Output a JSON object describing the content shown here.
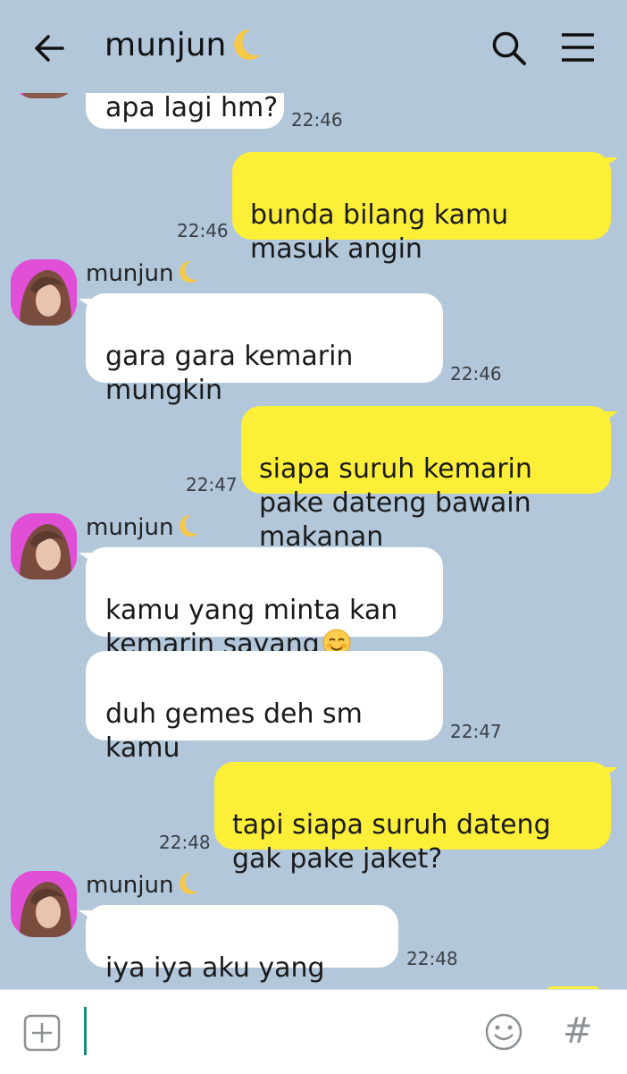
{
  "header": {
    "title": "munjun"
  },
  "messages": [
    {
      "text": "apa lagi hm?",
      "time": "22:46"
    },
    {
      "text": "bunda bilang kamu masuk angin",
      "time": "22:46"
    },
    {
      "sender": "munjun",
      "text": "gara gara kemarin mungkin",
      "time": "22:46"
    },
    {
      "text": "siapa suruh kemarin pake dateng bawain makanan",
      "time": "22:47"
    },
    {
      "sender": "munjun",
      "text": "kamu yang minta kan kemarin sayang"
    },
    {
      "text": "duh gemes deh sm kamu",
      "time": "22:47"
    },
    {
      "text": "tapi siapa suruh dateng gak pake jaket?",
      "time": "22:48"
    },
    {
      "sender": "munjun",
      "text": "iya iya aku yang salah",
      "time": "22:48"
    }
  ],
  "colors": {
    "background": "#b2c7da",
    "outgoing_bubble": "#fdef38",
    "incoming_bubble": "#ffffff",
    "avatar_bg": "#e04fd6"
  },
  "icons": [
    "back-arrow",
    "search",
    "menu",
    "add",
    "emoji",
    "hashtag",
    "crescent-moon",
    "smiling-face"
  ],
  "input": {
    "value": "",
    "hash_symbol": "#"
  }
}
